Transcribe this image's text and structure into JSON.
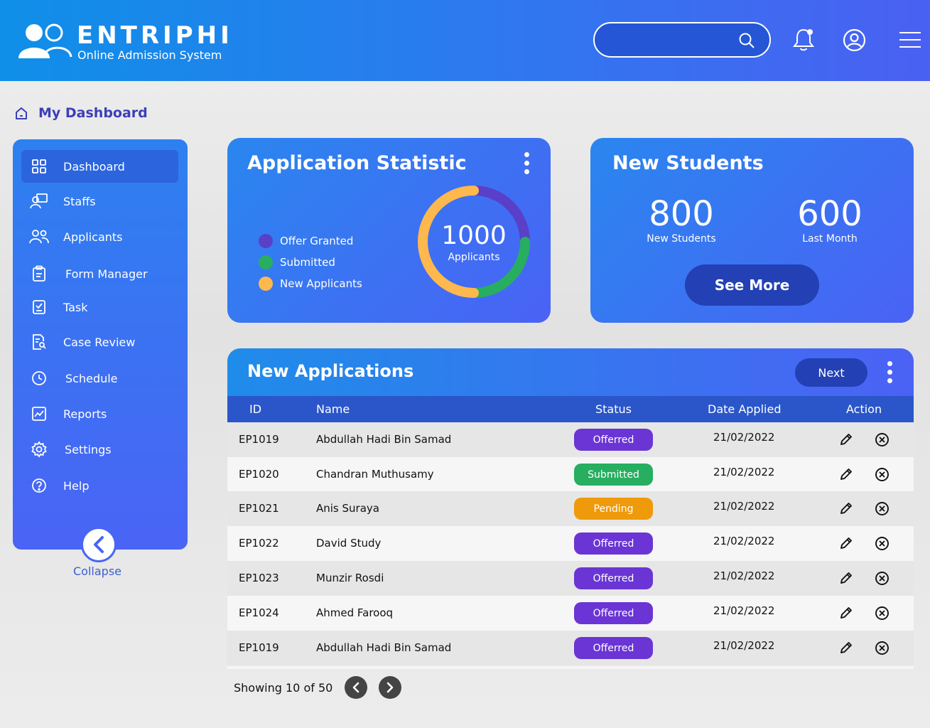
{
  "header": {
    "brand": "ENTRIPHI",
    "subtitle": "Online Admission System",
    "search_placeholder": ""
  },
  "breadcrumb": {
    "label": "My Dashboard"
  },
  "sidebar": {
    "items": [
      {
        "label": "Dashboard",
        "icon": "grid-icon",
        "active": true
      },
      {
        "label": "Staffs",
        "icon": "staff-icon",
        "active": false
      },
      {
        "label": "Applicants",
        "icon": "users-icon",
        "active": false
      },
      {
        "label": "Form Manager",
        "icon": "clipboard-icon",
        "active": false
      },
      {
        "label": "Task",
        "icon": "task-check-icon",
        "active": false
      },
      {
        "label": "Case Review",
        "icon": "document-search-icon",
        "active": false
      },
      {
        "label": "Schedule",
        "icon": "clock-icon",
        "active": false
      },
      {
        "label": "Reports",
        "icon": "chart-icon",
        "active": false
      },
      {
        "label": "Settings",
        "icon": "gear-icon",
        "active": false
      },
      {
        "label": "Help",
        "icon": "help-icon",
        "active": false
      }
    ],
    "collapse_label": "Collapse"
  },
  "stats_card": {
    "title": "Application Statistic",
    "total": "1000",
    "total_label": "Applicants",
    "legend": [
      {
        "label": "Offer Granted",
        "color": "#5a3fc8"
      },
      {
        "label": "Submitted",
        "color": "#27ae60"
      },
      {
        "label": "New Applicants",
        "color": "#ffb84d"
      }
    ]
  },
  "chart_data": {
    "type": "pie",
    "title": "",
    "categories": [
      "Offer Granted",
      "Submitted",
      "New Applicants"
    ],
    "values": [
      25,
      25,
      50
    ],
    "colors": [
      "#5a3fc8",
      "#27ae60",
      "#ffb84d"
    ]
  },
  "students_card": {
    "title": "New Students",
    "new_value": "800",
    "new_label": "New Students",
    "last_value": "600",
    "last_label": "Last Month",
    "button": "See More"
  },
  "applications": {
    "title": "New Applications",
    "next_label": "Next",
    "columns": {
      "id": "ID",
      "name": "Name",
      "status": "Status",
      "date": "Date Applied",
      "action": "Action"
    },
    "rows": [
      {
        "id": "EP1019",
        "name": "Abdullah Hadi Bin Samad",
        "status": "Offerred",
        "status_color": "#6a35d4",
        "date": "21/02/2022"
      },
      {
        "id": "EP1020",
        "name": "Chandran Muthusamy",
        "status": "Submitted",
        "status_color": "#27ae60",
        "date": "21/02/2022"
      },
      {
        "id": "EP1021",
        "name": "Anis Suraya",
        "status": "Pending",
        "status_color": "#ef9a0a",
        "date": "21/02/2022"
      },
      {
        "id": "EP1022",
        "name": "David Study",
        "status": "Offerred",
        "status_color": "#6a35d4",
        "date": "21/02/2022"
      },
      {
        "id": "EP1023",
        "name": "Munzir Rosdi",
        "status": "Offerred",
        "status_color": "#6a35d4",
        "date": "21/02/2022"
      },
      {
        "id": "EP1024",
        "name": "Ahmed Farooq",
        "status": "Offerred",
        "status_color": "#6a35d4",
        "date": "21/02/2022"
      },
      {
        "id": "EP1019",
        "name": "Abdullah Hadi Bin Samad",
        "status": "Offerred",
        "status_color": "#6a35d4",
        "date": "21/02/2022"
      }
    ],
    "showing": "Showing 10 of 50"
  }
}
